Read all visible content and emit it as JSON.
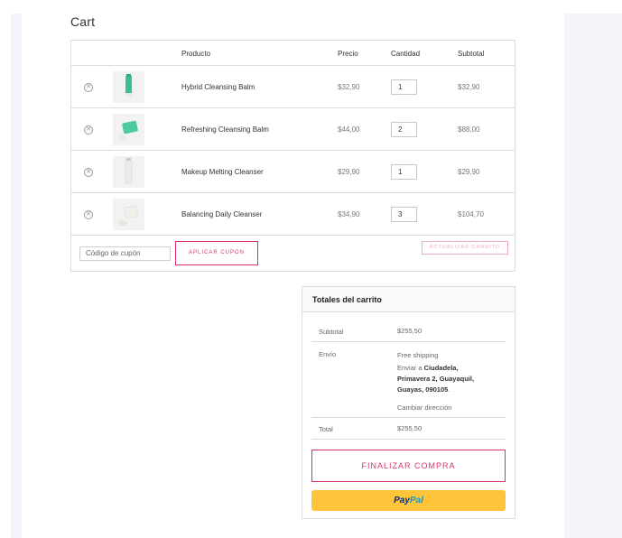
{
  "page": {
    "title": "Cart"
  },
  "table": {
    "headers": {
      "product": "Producto",
      "price": "Precio",
      "quantity": "Cantidad",
      "subtotal": "Subtotal"
    },
    "rows": [
      {
        "name": "Hybrid Cleansing Balm",
        "price": "$32,90",
        "qty": "1",
        "subtotal": "$32,90"
      },
      {
        "name": "Refreshing Cleansing Balm",
        "price": "$44,00",
        "qty": "2",
        "subtotal": "$88,00"
      },
      {
        "name": "Makeup Melting Cleanser",
        "price": "$29,90",
        "qty": "1",
        "subtotal": "$29,90"
      },
      {
        "name": "Balancing Daily Cleanser",
        "price": "$34,90",
        "qty": "3",
        "subtotal": "$104,70"
      }
    ],
    "remove_icon": "remove-circle-icon"
  },
  "coupon": {
    "placeholder": "Código de cupón",
    "apply_label": "APLICAR CUPON",
    "update_label": "ACTUALIZAR CARRITO"
  },
  "totals": {
    "title": "Totales del carrito",
    "subtotal_label": "Subtotal",
    "subtotal_value": "$255,50",
    "shipping_label": "Envío",
    "shipping_method": "Free shipping",
    "ship_to_prefix": "Enviar a",
    "ship_to_line1": "Ciudadela,",
    "ship_to_line2": "Primavera 2, Guayaquil,",
    "ship_to_line3": "Guayas, 090105",
    "ship_to_suffix": ".",
    "change_address": "Cambiar dirección",
    "total_label": "Total",
    "total_value": "$255,50",
    "checkout_label": "FINALIZAR COMPRA",
    "paypal_part1": "Pay",
    "paypal_part2": "Pal"
  },
  "colors": {
    "accent": "#d6336c",
    "accent_light": "#f3a9c3",
    "paypal_yellow": "#ffc439",
    "border": "#dcdcdc"
  }
}
